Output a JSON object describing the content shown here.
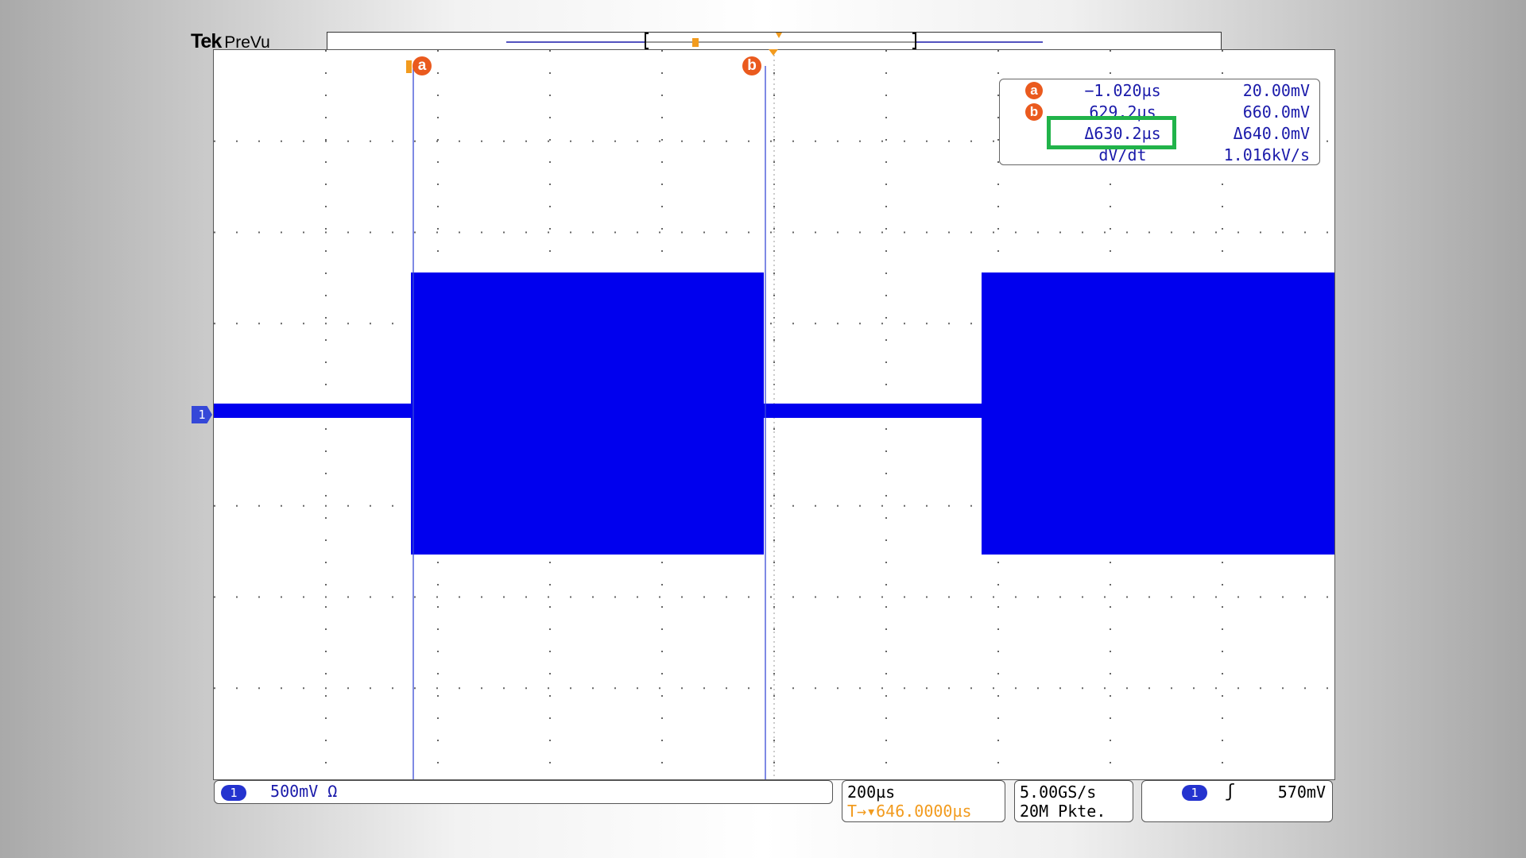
{
  "header": {
    "brand": "Tek",
    "mode": "PreVu"
  },
  "cursors": {
    "a_label": "a",
    "b_label": "b"
  },
  "measurements": {
    "rows": [
      {
        "badge": "a",
        "time": "−1.020µs",
        "volt": "20.00mV"
      },
      {
        "badge": "b",
        "time": "629.2µs",
        "volt": "660.0mV"
      },
      {
        "badge": "",
        "time": "Δ630.2µs",
        "volt": "Δ640.0mV"
      },
      {
        "badge": "",
        "time": "dV/dt",
        "volt": "1.016kV/s"
      }
    ]
  },
  "channel_marker": "1",
  "status": {
    "channel_num": "1",
    "channel_scale": "500mV Ω",
    "timebase": "200µs",
    "trigger_position": "T→▾646.0000µs",
    "sample_rate": "5.00GS/s",
    "record_length": "20M Pkte.",
    "trigger_channel": "1",
    "trigger_slope_icon": "rising-edge-icon",
    "trigger_slope": "ʃ",
    "trigger_level": "570mV"
  },
  "colors": {
    "trace": "#0000ee",
    "cursor_badge": "#ea5a1e",
    "highlight": "#21b34a",
    "trigger": "#f29b1e"
  }
}
